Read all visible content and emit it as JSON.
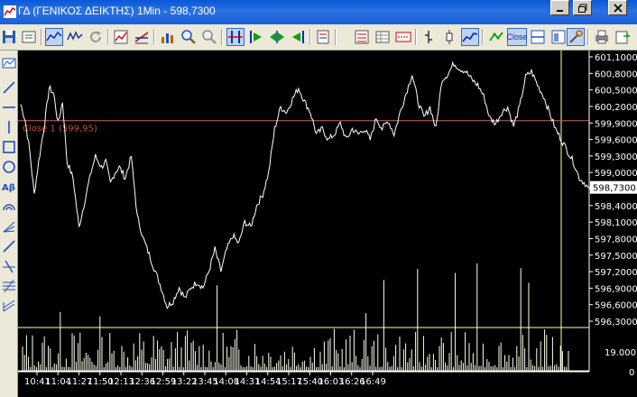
{
  "window": {
    "title": "ΓΔ (ΓΕΝΙΚΟΣ ΔΕΙΚΤΗΣ) 1Min - 598,7300"
  },
  "toolbar": {
    "close_label": "Close",
    "icons": [
      "save-icon",
      "properties-icon",
      "line-chart-icon",
      "candle-chart-icon",
      "refresh-icon",
      "chart-type-icon",
      "indicator-icon",
      "bar-volume-icon",
      "zoom-in-icon",
      "zoom-out-icon",
      "crosshair-icon",
      "play-start-icon",
      "play-pair-icon",
      "play-back-icon",
      "calc-icon",
      "fib-icon",
      "grid-icon",
      "value-icon",
      "tick-icon",
      "ohlc-icon",
      "linechart-icon",
      "trend-icon",
      "close-button",
      "split-icon",
      "layout-icon",
      "settings-icon",
      "print-icon",
      "export-icon"
    ]
  },
  "colors": {
    "background": "#000000",
    "price_line": "#ffffff",
    "grid_line": "#ffffaa",
    "close_line": "#c86464",
    "close_label": "#c84646",
    "axis_text": "#ffffff",
    "axis_bg": "#ffffff"
  },
  "chart_data": {
    "type": "line",
    "current_value_label": "598,7300",
    "close_reference": {
      "label": "Close 1 (599,95)",
      "value": 599.95
    },
    "price_axis": {
      "ticks": [
        "601,1000",
        "600,8000",
        "600,5000",
        "600,2000",
        "599,9000",
        "599,6000",
        "599,3000",
        "599,0000",
        "598,7000",
        "598,4000",
        "598,1000",
        "597,8000",
        "597,5000",
        "597,2000",
        "596,9000",
        "596,6000",
        "596,3000"
      ],
      "ylim": [
        596.3,
        601.1
      ]
    },
    "volume_axis": {
      "ticks": [
        "19.000",
        "0"
      ]
    },
    "time_axis": {
      "ticks": [
        "10:41",
        "11:04",
        "11:27",
        "11:50",
        "12:13",
        "12:36",
        "12:59",
        "13:22",
        "13:45",
        "14:08",
        "14:31",
        "14:54",
        "15:17",
        "15:40",
        "16:03",
        "16:26",
        "16:49"
      ]
    },
    "price_anchors": [
      [
        0,
        600.25
      ],
      [
        3,
        599.95
      ],
      [
        6,
        599.4
      ],
      [
        9,
        598.6
      ],
      [
        12,
        599.2
      ],
      [
        16,
        599.9
      ],
      [
        19,
        600.55
      ],
      [
        22,
        600.45
      ],
      [
        25,
        599.9
      ],
      [
        28,
        600.3
      ],
      [
        31,
        599.2
      ],
      [
        35,
        598.9
      ],
      [
        39,
        598.0
      ],
      [
        43,
        598.5
      ],
      [
        47,
        599.0
      ],
      [
        50,
        599.3
      ],
      [
        54,
        599.1
      ],
      [
        57,
        599.2
      ],
      [
        60,
        598.8
      ],
      [
        63,
        599.0
      ],
      [
        66,
        599.1
      ],
      [
        70,
        598.9
      ],
      [
        74,
        599.3
      ],
      [
        78,
        598.2
      ],
      [
        82,
        597.8
      ],
      [
        86,
        597.5
      ],
      [
        90,
        597.2
      ],
      [
        94,
        596.9
      ],
      [
        98,
        596.55
      ],
      [
        102,
        596.65
      ],
      [
        106,
        596.9
      ],
      [
        110,
        596.7
      ],
      [
        114,
        596.9
      ],
      [
        118,
        597.0
      ],
      [
        122,
        596.9
      ],
      [
        126,
        597.2
      ],
      [
        130,
        597.6
      ],
      [
        134,
        597.2
      ],
      [
        138,
        597.6
      ],
      [
        142,
        597.85
      ],
      [
        146,
        597.7
      ],
      [
        150,
        598.1
      ],
      [
        154,
        598.0
      ],
      [
        158,
        598.4
      ],
      [
        162,
        598.6
      ],
      [
        166,
        599.0
      ],
      [
        170,
        599.8
      ],
      [
        174,
        600.2
      ],
      [
        178,
        600.1
      ],
      [
        182,
        600.35
      ],
      [
        186,
        600.55
      ],
      [
        190,
        600.3
      ],
      [
        194,
        600.1
      ],
      [
        198,
        599.7
      ],
      [
        202,
        599.8
      ],
      [
        206,
        599.6
      ],
      [
        210,
        599.7
      ],
      [
        214,
        599.9
      ],
      [
        218,
        599.6
      ],
      [
        222,
        599.8
      ],
      [
        226,
        599.7
      ],
      [
        230,
        599.8
      ],
      [
        234,
        599.6
      ],
      [
        238,
        600.0
      ],
      [
        242,
        599.8
      ],
      [
        246,
        599.95
      ],
      [
        250,
        599.7
      ],
      [
        254,
        600.1
      ],
      [
        258,
        600.45
      ],
      [
        262,
        600.8
      ],
      [
        266,
        600.3
      ],
      [
        270,
        600.0
      ],
      [
        274,
        600.2
      ],
      [
        278,
        599.8
      ],
      [
        282,
        600.7
      ],
      [
        286,
        600.8
      ],
      [
        290,
        601.0
      ],
      [
        294,
        600.9
      ],
      [
        298,
        600.85
      ],
      [
        302,
        600.7
      ],
      [
        306,
        600.6
      ],
      [
        310,
        600.4
      ],
      [
        314,
        600.0
      ],
      [
        318,
        599.9
      ],
      [
        322,
        600.1
      ],
      [
        326,
        600.2
      ],
      [
        330,
        599.85
      ],
      [
        334,
        600.2
      ],
      [
        338,
        600.75
      ],
      [
        342,
        600.85
      ],
      [
        346,
        600.6
      ],
      [
        350,
        600.4
      ],
      [
        354,
        600.1
      ],
      [
        358,
        599.8
      ],
      [
        362,
        599.6
      ],
      [
        366,
        599.4
      ],
      [
        370,
        599.2
      ],
      [
        374,
        598.9
      ],
      [
        378,
        598.8
      ],
      [
        380,
        598.73
      ]
    ]
  }
}
